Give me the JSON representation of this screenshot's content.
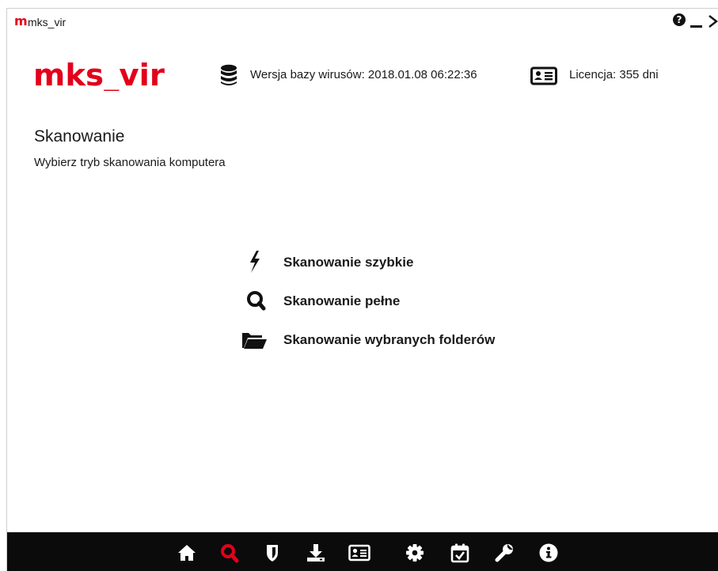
{
  "window": {
    "app_icon_letter": "m",
    "title": "mks_vir",
    "help_symbol": "?"
  },
  "header": {
    "logo_text": "mks_vir",
    "database_label": "Wersja bazy wirusów: 2018.01.08 06:22:36",
    "license_label": "Licencja: 355 dni"
  },
  "section": {
    "title": "Skanowanie",
    "subtitle": "Wybierz tryb skanowania komputera"
  },
  "scan_options": [
    {
      "label": "Skanowanie szybkie",
      "icon": "lightning-icon"
    },
    {
      "label": "Skanowanie pełne",
      "icon": "magnifier-icon"
    },
    {
      "label": "Skanowanie wybranych folderów",
      "icon": "folder-open-icon"
    }
  ],
  "toolbar": {
    "items": [
      {
        "icon": "home-icon",
        "active": false
      },
      {
        "icon": "search-icon",
        "active": true
      },
      {
        "icon": "shield-icon",
        "active": false
      },
      {
        "icon": "download-icon",
        "active": false
      },
      {
        "icon": "id-card-icon",
        "active": false
      },
      {
        "icon": "gear-icon",
        "active": false
      },
      {
        "icon": "calendar-check-icon",
        "active": false
      },
      {
        "icon": "wrench-icon",
        "active": false
      },
      {
        "icon": "info-icon",
        "active": false
      }
    ]
  },
  "colors": {
    "brand_red": "#e3001b",
    "toolbar_bg": "#0b0b0b",
    "toolbar_icon": "#ffffff",
    "text": "#1a1a1a"
  }
}
